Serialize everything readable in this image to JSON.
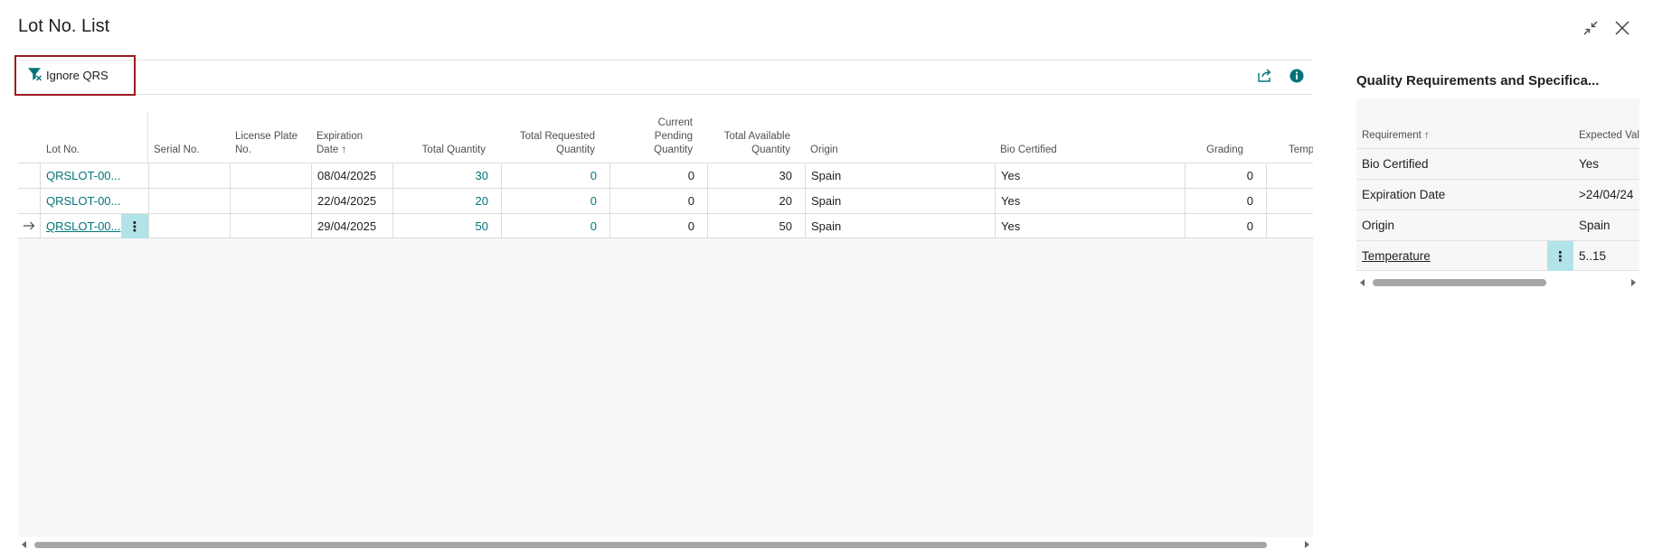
{
  "window": {
    "title": "Lot No. List",
    "collapse_icon": "collapse-arrows-icon",
    "close_icon": "close-icon"
  },
  "toolbar": {
    "ignore_label": "Ignore QRS",
    "ignore_icon": "filter-clear-icon",
    "share_icon": "share-icon",
    "info_icon": "info-icon"
  },
  "grid": {
    "columns": [
      {
        "key": "lot",
        "label": "Lot No."
      },
      {
        "key": "serial",
        "label": "Serial No."
      },
      {
        "key": "license",
        "label": "License Plate No."
      },
      {
        "key": "exp",
        "label": "Expiration Date ↑"
      },
      {
        "key": "totq",
        "label": "Total Quantity"
      },
      {
        "key": "treq",
        "label": "Total Requested Quantity"
      },
      {
        "key": "cpend",
        "label": "Current Pending Quantity"
      },
      {
        "key": "tavail",
        "label": "Total Available Quantity"
      },
      {
        "key": "origin",
        "label": "Origin"
      },
      {
        "key": "bio",
        "label": "Bio Certified"
      },
      {
        "key": "grading",
        "label": "Grading"
      },
      {
        "key": "temp",
        "label": "Temp"
      }
    ],
    "rows": [
      {
        "lot": "QRSLOT-00...",
        "serial": "",
        "license": "",
        "exp": "08/04/2025",
        "totq": "30",
        "treq": "0",
        "cpend": "0",
        "tavail": "30",
        "origin": "Spain",
        "bio": "Yes",
        "grading": "0"
      },
      {
        "lot": "QRSLOT-00...",
        "serial": "",
        "license": "",
        "exp": "22/04/2025",
        "totq": "20",
        "treq": "0",
        "cpend": "0",
        "tavail": "20",
        "origin": "Spain",
        "bio": "Yes",
        "grading": "0"
      },
      {
        "lot": "QRSLOT-00...",
        "serial": "",
        "license": "",
        "exp": "29/04/2025",
        "totq": "50",
        "treq": "0",
        "cpend": "0",
        "tavail": "50",
        "origin": "Spain",
        "bio": "Yes",
        "grading": "0",
        "selected": true
      }
    ],
    "row_menu_glyph": "⋮",
    "current_row_icon": "right-arrow-icon"
  },
  "factbox": {
    "title": "Quality Requirements and Specifica...",
    "col_requirement": "Requirement ↑",
    "col_expected": "Expected Val",
    "rows": [
      {
        "requirement": "Bio Certified",
        "expected": "Yes"
      },
      {
        "requirement": "Expiration Date",
        "expected": ">24/04/24"
      },
      {
        "requirement": "Origin",
        "expected": "Spain"
      },
      {
        "requirement": "Temperature",
        "expected": "5..15",
        "selected": true
      }
    ],
    "row_menu_glyph": "⋮"
  },
  "colors": {
    "accent_teal": "#00747a",
    "highlight_border": "#9b1c1f",
    "selection_bg": "#b2e3e8"
  }
}
